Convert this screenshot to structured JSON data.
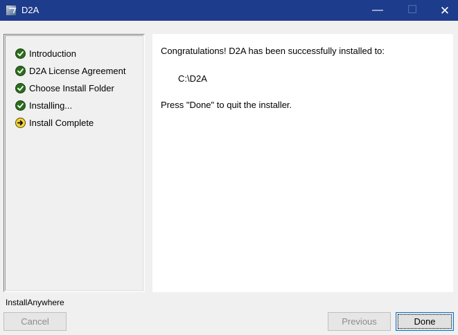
{
  "window": {
    "title": "D2A",
    "icons": {
      "app": "installer-app-icon",
      "minimize": "minimize-icon",
      "maximize": "maximize-icon",
      "close": "close-icon"
    },
    "minimize_glyph": "—",
    "maximize_glyph": "☐",
    "close_glyph": "✕"
  },
  "steps": [
    {
      "label": "Introduction",
      "status": "complete",
      "icon": "check-icon"
    },
    {
      "label": "D2A License Agreement",
      "status": "complete",
      "icon": "check-icon"
    },
    {
      "label": "Choose Install Folder",
      "status": "complete",
      "icon": "check-icon"
    },
    {
      "label": "Installing...",
      "status": "complete",
      "icon": "check-icon"
    },
    {
      "label": "Install Complete",
      "status": "current",
      "icon": "arrow-right-icon"
    }
  ],
  "content": {
    "message": "Congratulations! D2A has been successfully installed to:",
    "install_path": "C:\\D2A",
    "instruction": "Press \"Done\" to quit the installer."
  },
  "footer": {
    "brand": "InstallAnywhere",
    "cancel_label": "Cancel",
    "previous_label": "Previous",
    "done_label": "Done"
  },
  "colors": {
    "titlebar": "#1e3c8c",
    "check": "#2b6e1b",
    "current_step": "#f2d23a",
    "focus_border": "#0078d7"
  }
}
